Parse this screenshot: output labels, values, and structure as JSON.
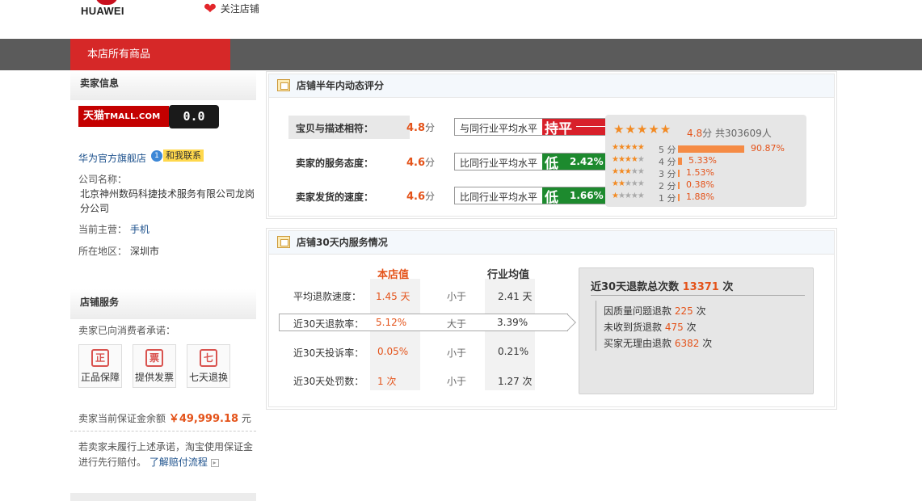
{
  "header": {
    "brand": "HUAWEI",
    "follow_label": "关注店铺"
  },
  "nav": {
    "active_tab": "本店所有商品"
  },
  "sidebar": {
    "seller_info_title": "卖家信息",
    "tmall_badge_cn": "天猫",
    "tmall_badge_en": "TMALL.COM",
    "tmall_cat_face": "0.0",
    "shop_name": "华为官方旗舰店",
    "contact_label": "和我联系",
    "company_label": "公司名称：",
    "company_name": "北京神州数码科捷技术服务有限公司龙岗分公司",
    "main_business_label": "当前主营：",
    "main_business": "手机",
    "location_label": "所在地区：",
    "location": "深圳市",
    "service_title": "店铺服务",
    "promise_label": "卖家已向消费者承诺：",
    "badges": [
      {
        "icon": "正",
        "label": "正品保障"
      },
      {
        "icon": "票",
        "label": "提供发票"
      },
      {
        "icon": "七",
        "label": "七天退换"
      }
    ],
    "deposit_label": "卖家当前保证金余额",
    "deposit_amount": "￥49,999.18",
    "deposit_unit": "元",
    "note_text": "若卖家未履行上述承诺，淘宝使用保证金进行先行赔付。",
    "note_link": "了解赔付流程"
  },
  "rating_panel": {
    "title": "店铺半年内动态评分",
    "rows": [
      {
        "label": "宝贝与描述相符：",
        "score": "4.8",
        "unit": "分",
        "compare": "与同行业平均水平",
        "tag": "持平",
        "pct": "",
        "tone": "red"
      },
      {
        "label": "卖家的服务态度：",
        "score": "4.6",
        "unit": "分",
        "compare": "比同行业平均水平",
        "tag": "低",
        "pct": "2.42%",
        "tone": "green"
      },
      {
        "label": "卖家发货的速度：",
        "score": "4.6",
        "unit": "分",
        "compare": "比同行业平均水平",
        "tag": "低",
        "pct": "1.66%",
        "tone": "green"
      }
    ],
    "summary_score": "4.8",
    "summary_unit": "分",
    "summary_count": "共303609人",
    "distribution": [
      {
        "stars": 5,
        "label": "5 分",
        "pct": "90.87%",
        "fraction": 0.9087
      },
      {
        "stars": 4,
        "label": "4 分",
        "pct": "5.33%",
        "fraction": 0.0533
      },
      {
        "stars": 3,
        "label": "3 分",
        "pct": "1.53%",
        "fraction": 0.0153
      },
      {
        "stars": 2,
        "label": "2 分",
        "pct": "0.38%",
        "fraction": 0.0038
      },
      {
        "stars": 1,
        "label": "1 分",
        "pct": "1.88%",
        "fraction": 0.0188
      }
    ]
  },
  "service_panel": {
    "title": "店铺30天内服务情况",
    "col_shop": "本店值",
    "col_industry": "行业均值",
    "rows": [
      {
        "label": "平均退款速度：",
        "shop": "1.45 天",
        "cmp": "小于",
        "industry": "2.41 天"
      },
      {
        "label": "近30天退款率：",
        "shop": "5.12%",
        "cmp": "大于",
        "industry": "3.39%"
      },
      {
        "label": "近30天投诉率：",
        "shop": "0.05%",
        "cmp": "小于",
        "industry": "0.21%"
      },
      {
        "label": "近30天处罚数：",
        "shop": "1 次",
        "cmp": "小于",
        "industry": "1.27 次"
      }
    ],
    "refund_title": "近30天退款总次数",
    "refund_total": "13371",
    "refund_unit": "次",
    "refund_items": [
      {
        "label": "因质量问题退款",
        "count": "225",
        "unit": "次"
      },
      {
        "label": "未收到货退款",
        "count": "475",
        "unit": "次"
      },
      {
        "label": "买家无理由退款",
        "count": "6382",
        "unit": "次"
      }
    ]
  },
  "colors": {
    "accent_red": "#d62828",
    "nav_gray": "#5b5b5b",
    "score_orange": "#e4531a",
    "tag_green": "#1d8a2e",
    "link_blue": "#1a4f8b"
  }
}
